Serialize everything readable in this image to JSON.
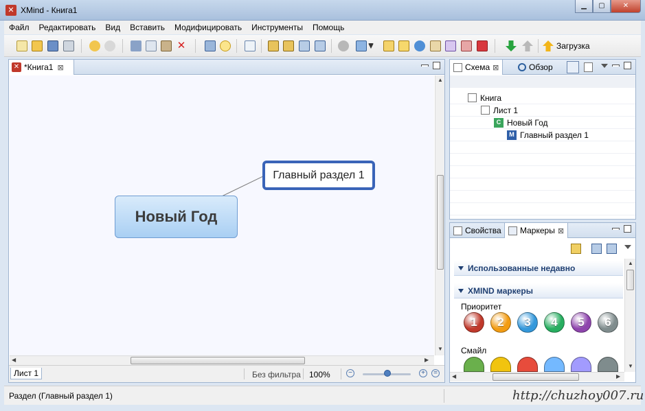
{
  "window": {
    "title": "XMind - Книга1",
    "icon_name": "xmind-icon"
  },
  "menu": [
    "Файл",
    "Редактировать",
    "Вид",
    "Вставить",
    "Модифицировать",
    "Инструменты",
    "Помощь"
  ],
  "toolbar": {
    "upload_label": "Загрузка"
  },
  "editor": {
    "tab_label": "*Книга1",
    "central_topic": "Новый Год",
    "main_topic": "Главный раздел 1",
    "sheet_tab": "Лист 1",
    "filter_label": "Без фильтра",
    "zoom_label": "100%",
    "zoom_level_percent": 100
  },
  "outline": {
    "tabs": [
      "Схема",
      "Обзор"
    ],
    "tree": [
      "Книга",
      "Лист 1",
      "Новый Год",
      "Главный раздел 1"
    ],
    "tree_badges": [
      "C",
      "M"
    ]
  },
  "markers": {
    "tabs": [
      "Свойства",
      "Маркеры"
    ],
    "sections": [
      "Использованные недавно",
      "XMIND маркеры"
    ],
    "priority_label": "Приоритет",
    "priority_values": [
      "1",
      "2",
      "3",
      "4",
      "5",
      "6"
    ],
    "priority_colors": [
      "#c0392b",
      "#f39c12",
      "#3498db",
      "#27ae60",
      "#8e44ad",
      "#7f8c8d"
    ],
    "smile_label": "Смайл",
    "smile_colors": [
      "#6ab04c",
      "#f1c40f",
      "#e74c3c",
      "#74b9ff",
      "#a29bfe",
      "#7f8c8d"
    ]
  },
  "status": {
    "text": "Раздел (Главный раздел 1)"
  },
  "watermark": "http://chuzhoy007.ru"
}
